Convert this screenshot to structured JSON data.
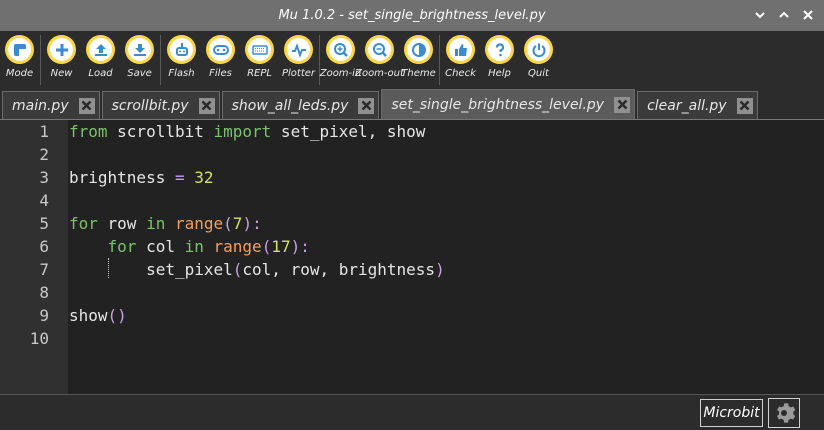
{
  "window": {
    "title": "Mu 1.0.2 - set_single_brightness_level.py"
  },
  "toolbar": {
    "buttons": [
      {
        "label": "Mode",
        "icon": "mode-icon"
      },
      {
        "label": "New",
        "icon": "plus-icon"
      },
      {
        "label": "Load",
        "icon": "upload-icon"
      },
      {
        "label": "Save",
        "icon": "download-icon"
      },
      {
        "label": "Flash",
        "icon": "flash-icon"
      },
      {
        "label": "Files",
        "icon": "files-icon"
      },
      {
        "label": "REPL",
        "icon": "keyboard-icon"
      },
      {
        "label": "Plotter",
        "icon": "pulse-icon"
      },
      {
        "label": "Zoom-in",
        "icon": "zoom-in-icon"
      },
      {
        "label": "Zoom-out",
        "icon": "zoom-out-icon"
      },
      {
        "label": "Theme",
        "icon": "theme-icon"
      },
      {
        "label": "Check",
        "icon": "thumbs-up-icon"
      },
      {
        "label": "Help",
        "icon": "help-icon"
      },
      {
        "label": "Quit",
        "icon": "power-icon"
      }
    ]
  },
  "tabs": [
    {
      "label": "main.py",
      "active": false
    },
    {
      "label": "scrollbit.py",
      "active": false
    },
    {
      "label": "show_all_leds.py",
      "active": false
    },
    {
      "label": "set_single_brightness_level.py",
      "active": true
    },
    {
      "label": "clear_all.py",
      "active": false
    }
  ],
  "editor": {
    "line_numbers": [
      "1",
      "2",
      "3",
      "4",
      "5",
      "6",
      "7",
      "8",
      "9",
      "10"
    ],
    "lines": [
      [
        {
          "t": "from",
          "c": "kw"
        },
        {
          "t": " scrollbit ",
          "c": "plain"
        },
        {
          "t": "import",
          "c": "kw"
        },
        {
          "t": " set_pixel, show",
          "c": "plain"
        }
      ],
      [],
      [
        {
          "t": "brightness ",
          "c": "plain"
        },
        {
          "t": "=",
          "c": "op"
        },
        {
          "t": " ",
          "c": "plain"
        },
        {
          "t": "32",
          "c": "num"
        }
      ],
      [],
      [
        {
          "t": "for",
          "c": "kw"
        },
        {
          "t": " row ",
          "c": "plain"
        },
        {
          "t": "in",
          "c": "kw"
        },
        {
          "t": " ",
          "c": "plain"
        },
        {
          "t": "range",
          "c": "fn"
        },
        {
          "t": "(",
          "c": "op"
        },
        {
          "t": "7",
          "c": "num"
        },
        {
          "t": "):",
          "c": "op"
        }
      ],
      [
        {
          "t": "    ",
          "c": "plain"
        },
        {
          "t": "for",
          "c": "kw"
        },
        {
          "t": " col ",
          "c": "plain"
        },
        {
          "t": "in",
          "c": "kw"
        },
        {
          "t": " ",
          "c": "plain"
        },
        {
          "t": "range",
          "c": "fn"
        },
        {
          "t": "(",
          "c": "op"
        },
        {
          "t": "17",
          "c": "num"
        },
        {
          "t": "):",
          "c": "op"
        }
      ],
      [
        {
          "t": "        set_pixel",
          "c": "plain"
        },
        {
          "t": "(",
          "c": "op"
        },
        {
          "t": "col, row, brightness",
          "c": "plain"
        },
        {
          "t": ")",
          "c": "op"
        }
      ],
      [],
      [
        {
          "t": "show",
          "c": "plain"
        },
        {
          "t": "()",
          "c": "op"
        }
      ],
      []
    ]
  },
  "statusbar": {
    "mode": "Microbit"
  },
  "colors": {
    "button_ring": "#fbd745",
    "keyword": "#7cc26c",
    "operator": "#c6a0e6",
    "number": "#d5e06a",
    "builtin": "#f0a060"
  }
}
